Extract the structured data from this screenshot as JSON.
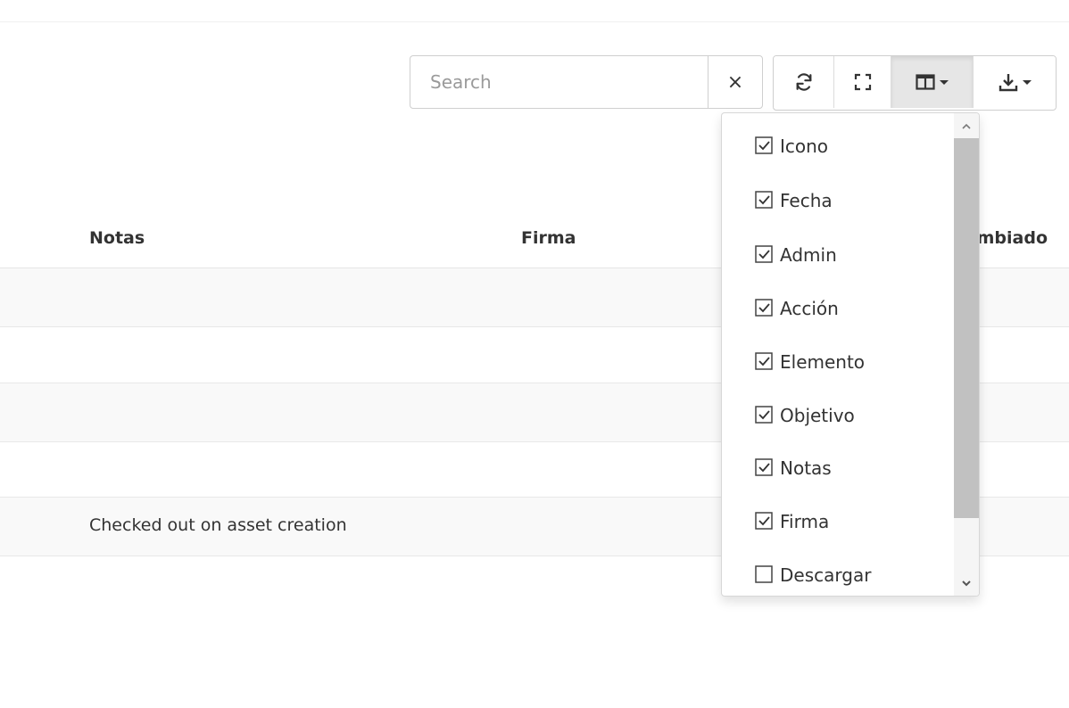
{
  "toolbar": {
    "search_placeholder": "Search",
    "clear_label": "×"
  },
  "table": {
    "headers": {
      "notas": "Notas",
      "firma": "Firma",
      "cambiado": "mbiado"
    },
    "rows": [
      {
        "notas": ""
      },
      {
        "notas": ""
      },
      {
        "notas": ""
      },
      {
        "notas": ""
      },
      {
        "notas": "Checked out on asset creation"
      }
    ]
  },
  "column_menu": {
    "items": [
      {
        "label": "Icono",
        "checked": true
      },
      {
        "label": "Fecha",
        "checked": true
      },
      {
        "label": "Admin",
        "checked": true
      },
      {
        "label": "Acción",
        "checked": true
      },
      {
        "label": "Elemento",
        "checked": true
      },
      {
        "label": "Objetivo",
        "checked": true
      },
      {
        "label": "Notas",
        "checked": true
      },
      {
        "label": "Firma",
        "checked": true
      },
      {
        "label": "Descargar",
        "checked": false
      }
    ]
  },
  "icons": {
    "refresh": "refresh-icon",
    "fullscreen": "fullscreen-icon",
    "columns": "columns-icon",
    "export": "download-icon"
  }
}
